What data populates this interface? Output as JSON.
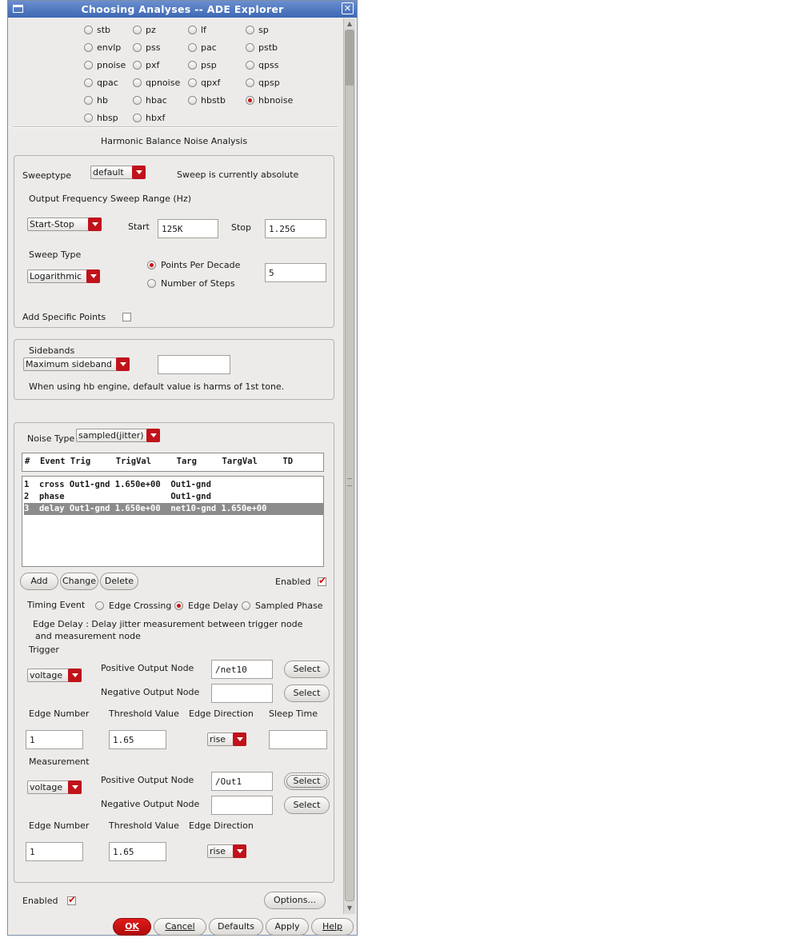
{
  "window": {
    "title": "Choosing Analyses -- ADE Explorer"
  },
  "analyses": [
    {
      "label": "stb",
      "selected": false
    },
    {
      "label": "pz",
      "selected": false
    },
    {
      "label": "lf",
      "selected": false
    },
    {
      "label": "sp",
      "selected": false
    },
    {
      "label": "envlp",
      "selected": false
    },
    {
      "label": "pss",
      "selected": false
    },
    {
      "label": "pac",
      "selected": false
    },
    {
      "label": "pstb",
      "selected": false
    },
    {
      "label": "pnoise",
      "selected": false
    },
    {
      "label": "pxf",
      "selected": false
    },
    {
      "label": "psp",
      "selected": false
    },
    {
      "label": "qpss",
      "selected": false
    },
    {
      "label": "qpac",
      "selected": false
    },
    {
      "label": "qpnoise",
      "selected": false
    },
    {
      "label": "qpxf",
      "selected": false
    },
    {
      "label": "qpsp",
      "selected": false
    },
    {
      "label": "hb",
      "selected": false
    },
    {
      "label": "hbac",
      "selected": false
    },
    {
      "label": "hbstb",
      "selected": false
    },
    {
      "label": "hbnoise",
      "selected": true
    },
    {
      "label": "hbsp",
      "selected": false
    },
    {
      "label": "hbxf",
      "selected": false
    }
  ],
  "section_title": "Harmonic Balance Noise Analysis",
  "sweep": {
    "sweeptype_label": "Sweeptype",
    "sweeptype_value": "default",
    "status": "Sweep is currently absolute",
    "range_label": "Output Frequency Sweep Range (Hz)",
    "range_mode": "Start-Stop",
    "start_label": "Start",
    "start_value": "125K",
    "stop_label": "Stop",
    "stop_value": "1.25G",
    "type_label": "Sweep Type",
    "type_value": "Logarithmic",
    "points_per_decade_label": "Points Per Decade",
    "number_of_steps_label": "Number of Steps",
    "points_value": "5",
    "add_points_label": "Add Specific Points"
  },
  "sidebands": {
    "label": "Sidebands",
    "mode": "Maximum sideband",
    "value": "",
    "note": "When using hb engine, default value is harms of 1st tone."
  },
  "noise": {
    "type_label": "Noise Type",
    "type_value": "sampled(jitter)",
    "table_header": "#  Event Trig     TrigVal     Targ     TargVal     TD",
    "rows": [
      {
        "text": "1  cross Out1-gnd 1.650e+00  Out1-gnd",
        "selected": false
      },
      {
        "text": "2  phase                     Out1-gnd",
        "selected": false
      },
      {
        "text": "3  delay Out1-gnd 1.650e+00  net10-gnd 1.650e+00",
        "selected": true
      }
    ],
    "add_label": "Add",
    "change_label": "Change",
    "delete_label": "Delete",
    "enabled_label": "Enabled"
  },
  "timing": {
    "label": "Timing Event",
    "options": [
      "Edge Crossing",
      "Edge Delay",
      "Sampled Phase"
    ],
    "selected": "Edge Delay",
    "description_line1": "Edge Delay : Delay jitter measurement between trigger node",
    "description_line2": "and measurement node"
  },
  "trigger": {
    "label": "Trigger",
    "kind": "voltage",
    "pos_label": "Positive Output Node",
    "pos_value": "/net10",
    "neg_label": "Negative Output Node",
    "neg_value": "",
    "select_label": "Select",
    "edge_number_label": "Edge Number",
    "threshold_label": "Threshold Value",
    "direction_label": "Edge Direction",
    "sleep_label": "Sleep Time",
    "edge_number": "1",
    "threshold": "1.65",
    "direction": "rise",
    "sleep": ""
  },
  "measurement": {
    "label": "Measurement",
    "kind": "voltage",
    "pos_label": "Positive Output Node",
    "pos_value": "/Out1",
    "neg_label": "Negative Output Node",
    "neg_value": "",
    "select_label": "Select",
    "edge_number_label": "Edge Number",
    "threshold_label": "Threshold Value",
    "direction_label": "Edge Direction",
    "edge_number": "1",
    "threshold": "1.65",
    "direction": "rise"
  },
  "footer": {
    "enabled_label": "Enabled",
    "options_label": "Options...",
    "ok_label": "OK",
    "cancel_label": "Cancel",
    "defaults_label": "Defaults",
    "apply_label": "Apply",
    "help_label": "Help"
  },
  "colors": {
    "accent": "#c1121a",
    "title_bar": "#4a73bd",
    "selection": "#8c8c8c"
  }
}
